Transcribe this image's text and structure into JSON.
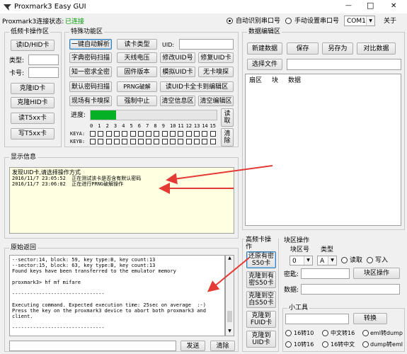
{
  "window": {
    "title": "Proxmark3 Easy GUI",
    "minimize": "—",
    "maximize": "□",
    "close": "✕"
  },
  "conn": {
    "label": "Proxmark3连接状态:",
    "status": "已连接",
    "auto_port": "自动识别串口号",
    "manual_port": "手动设置串口号",
    "port_value": "COM1",
    "about": "关于"
  },
  "lowfreq": {
    "title": "低频卡操作区",
    "read_id": "读ID/HID卡",
    "type_label": "类型:",
    "card_label": "卡号:",
    "clone_id": "克隆ID卡",
    "clone_hid": "克隆HID卡",
    "read_t5": "读T5xx卡",
    "write_t5": "写T5xx卡"
  },
  "special": {
    "title": "特殊功能区",
    "row1": [
      "一键自动解析",
      "读卡类型"
    ],
    "uid_label": "UID:",
    "row2": [
      "字典密码扫描",
      "天线电压",
      "修改UID号",
      "修复UID卡"
    ],
    "row3": [
      "知一密求全密",
      "固件版本",
      "模拟UID卡",
      "无卡嗅探"
    ],
    "row4": [
      "默认密码扫描",
      "PRNG破解",
      "读UID卡全卡到编辑区"
    ],
    "row5": [
      "现场有卡嗅探",
      "强制中止",
      "清空信息区",
      "清空编辑区"
    ],
    "progress_label": "进度:",
    "progress": 0.2,
    "read_btn": "读\n取",
    "clear_btn": "清\n除",
    "keya": "KEYA:",
    "keyb": "KEYB:",
    "sector_nums": [
      "0",
      "1",
      "2",
      "3",
      "4",
      "5",
      "6",
      "7",
      "8",
      "9",
      "10",
      "11",
      "12",
      "13",
      "14",
      "15"
    ]
  },
  "info": {
    "title": "显示信息",
    "lines": [
      "发现UID卡,请选择操作方式",
      "2016/11/7 23:05:52  正在测试该卡是否含有默认密码",
      "2016/11/7 23:06:02  正在进行PRNG破解操作"
    ]
  },
  "raw": {
    "title": "原始返回",
    "lines": [
      "--sector:14, block: 59, key type:B, key count:13",
      "--sector:15, block: 63, key type:B, key count:13",
      "Found keys have been transferred to the emulator memory",
      "",
      "proxmark3> hf mf mifare",
      "",
      "-------------------------------",
      "",
      "Executing command. Expected execution time: 25sec on average  :-)",
      "Press the key on the proxmark3 device to abort both proxmark3 and",
      "client.",
      "",
      "-------------------------------"
    ],
    "send": "发送",
    "clear": "清除"
  },
  "edit": {
    "title": "数据编辑区",
    "new": "新建数据",
    "save": "保存",
    "save_as": "另存为",
    "compare": "对比数据",
    "choose_file": "选择文件",
    "cols": [
      "扇区",
      "块",
      "数据"
    ]
  },
  "hf": {
    "title": "高频卡操作",
    "b1": "还原有密\nS50卡",
    "b2": "克隆到有\n密S50卡",
    "b3": "克隆到空\n白S50卡",
    "b4": "克隆到\nFUID卡",
    "b5": "克隆到\nUID卡"
  },
  "block": {
    "title": "块区操作",
    "block_label": "块区号",
    "type_label": "类型",
    "block_val": "0",
    "type_val": "A",
    "read": "读取",
    "write": "写入",
    "key_label": "密匙:",
    "op_btn": "块区操作",
    "data_label": "数据:"
  },
  "tools": {
    "title": "小工具",
    "convert": "转换",
    "r1": [
      "16转10",
      "中文转16",
      "eml转dump"
    ],
    "r2": [
      "10转16",
      "16转中文",
      "dump转eml"
    ]
  }
}
